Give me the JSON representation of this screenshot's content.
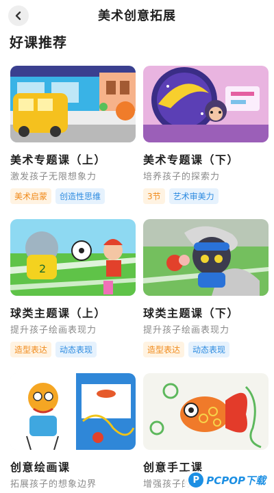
{
  "header": {
    "title": "美术创意拓展",
    "back_icon": "chevron-left-icon"
  },
  "section": {
    "title": "好课推荐"
  },
  "courses": [
    {
      "title": "美术专题课（上）",
      "subtitle": "激发孩子无限想象力",
      "tags": [
        {
          "label": "美术启蒙",
          "color": "orange"
        },
        {
          "label": "创造性思维",
          "color": "blue"
        }
      ],
      "thumbnail": "city-street-illustration"
    },
    {
      "title": "美术专题课（下）",
      "subtitle": "培养孩子的探索力",
      "tags": [
        {
          "label": "3节",
          "color": "orange"
        },
        {
          "label": "艺术审美力",
          "color": "blue"
        }
      ],
      "thumbnail": "banana-space-illustration"
    },
    {
      "title": "球类主题课（上）",
      "subtitle": "提升孩子绘画表现力",
      "tags": [
        {
          "label": "造型表达",
          "color": "orange"
        },
        {
          "label": "动态表现",
          "color": "blue"
        }
      ],
      "thumbnail": "soccer-field-illustration"
    },
    {
      "title": "球类主题课（下）",
      "subtitle": "提升孩子绘画表现力",
      "tags": [
        {
          "label": "造型表达",
          "color": "orange"
        },
        {
          "label": "动态表现",
          "color": "blue"
        }
      ],
      "thumbnail": "cat-goalkeeper-illustration"
    },
    {
      "title": "创意绘画课",
      "subtitle": "拓展孩子的想象边界",
      "tags": [],
      "thumbnail": "child-drawing-artwork"
    },
    {
      "title": "创意手工课",
      "subtitle": "增强孩子的",
      "tags": [],
      "thumbnail": "paper-quilling-goldfish"
    }
  ],
  "watermark": {
    "logo_letter": "P",
    "text": "PCPOP下载"
  },
  "colors": {
    "tag_orange": "#f08a1a",
    "tag_orange_bg": "#fff3e2",
    "tag_blue": "#2d8be0",
    "tag_blue_bg": "#e6f2fd"
  }
}
